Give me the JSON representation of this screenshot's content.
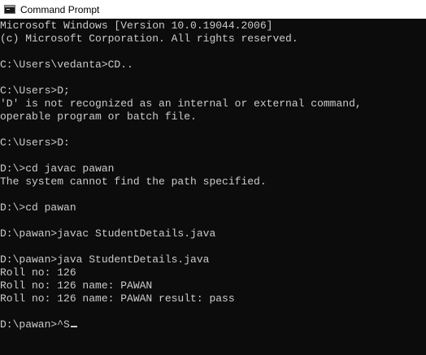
{
  "window": {
    "title": "Command Prompt",
    "icon": "cmd-icon"
  },
  "console": {
    "lines": [
      "Microsoft Windows [Version 10.0.19044.2006]",
      "(c) Microsoft Corporation. All rights reserved.",
      "",
      "C:\\Users\\vedanta>CD..",
      "",
      "C:\\Users>D;",
      "'D' is not recognized as an internal or external command,",
      "operable program or batch file.",
      "",
      "C:\\Users>D:",
      "",
      "D:\\>cd javac pawan",
      "The system cannot find the path specified.",
      "",
      "D:\\>cd pawan",
      "",
      "D:\\pawan>javac StudentDetails.java",
      "",
      "D:\\pawan>java StudentDetails.java",
      "Roll no: 126",
      "Roll no: 126 name: PAWAN",
      "Roll no: 126 name: PAWAN result: pass",
      ""
    ],
    "prompt": "D:\\pawan>^S"
  },
  "colors": {
    "background": "#0c0c0c",
    "text": "#cccccc",
    "titlebar": "#ffffff"
  }
}
